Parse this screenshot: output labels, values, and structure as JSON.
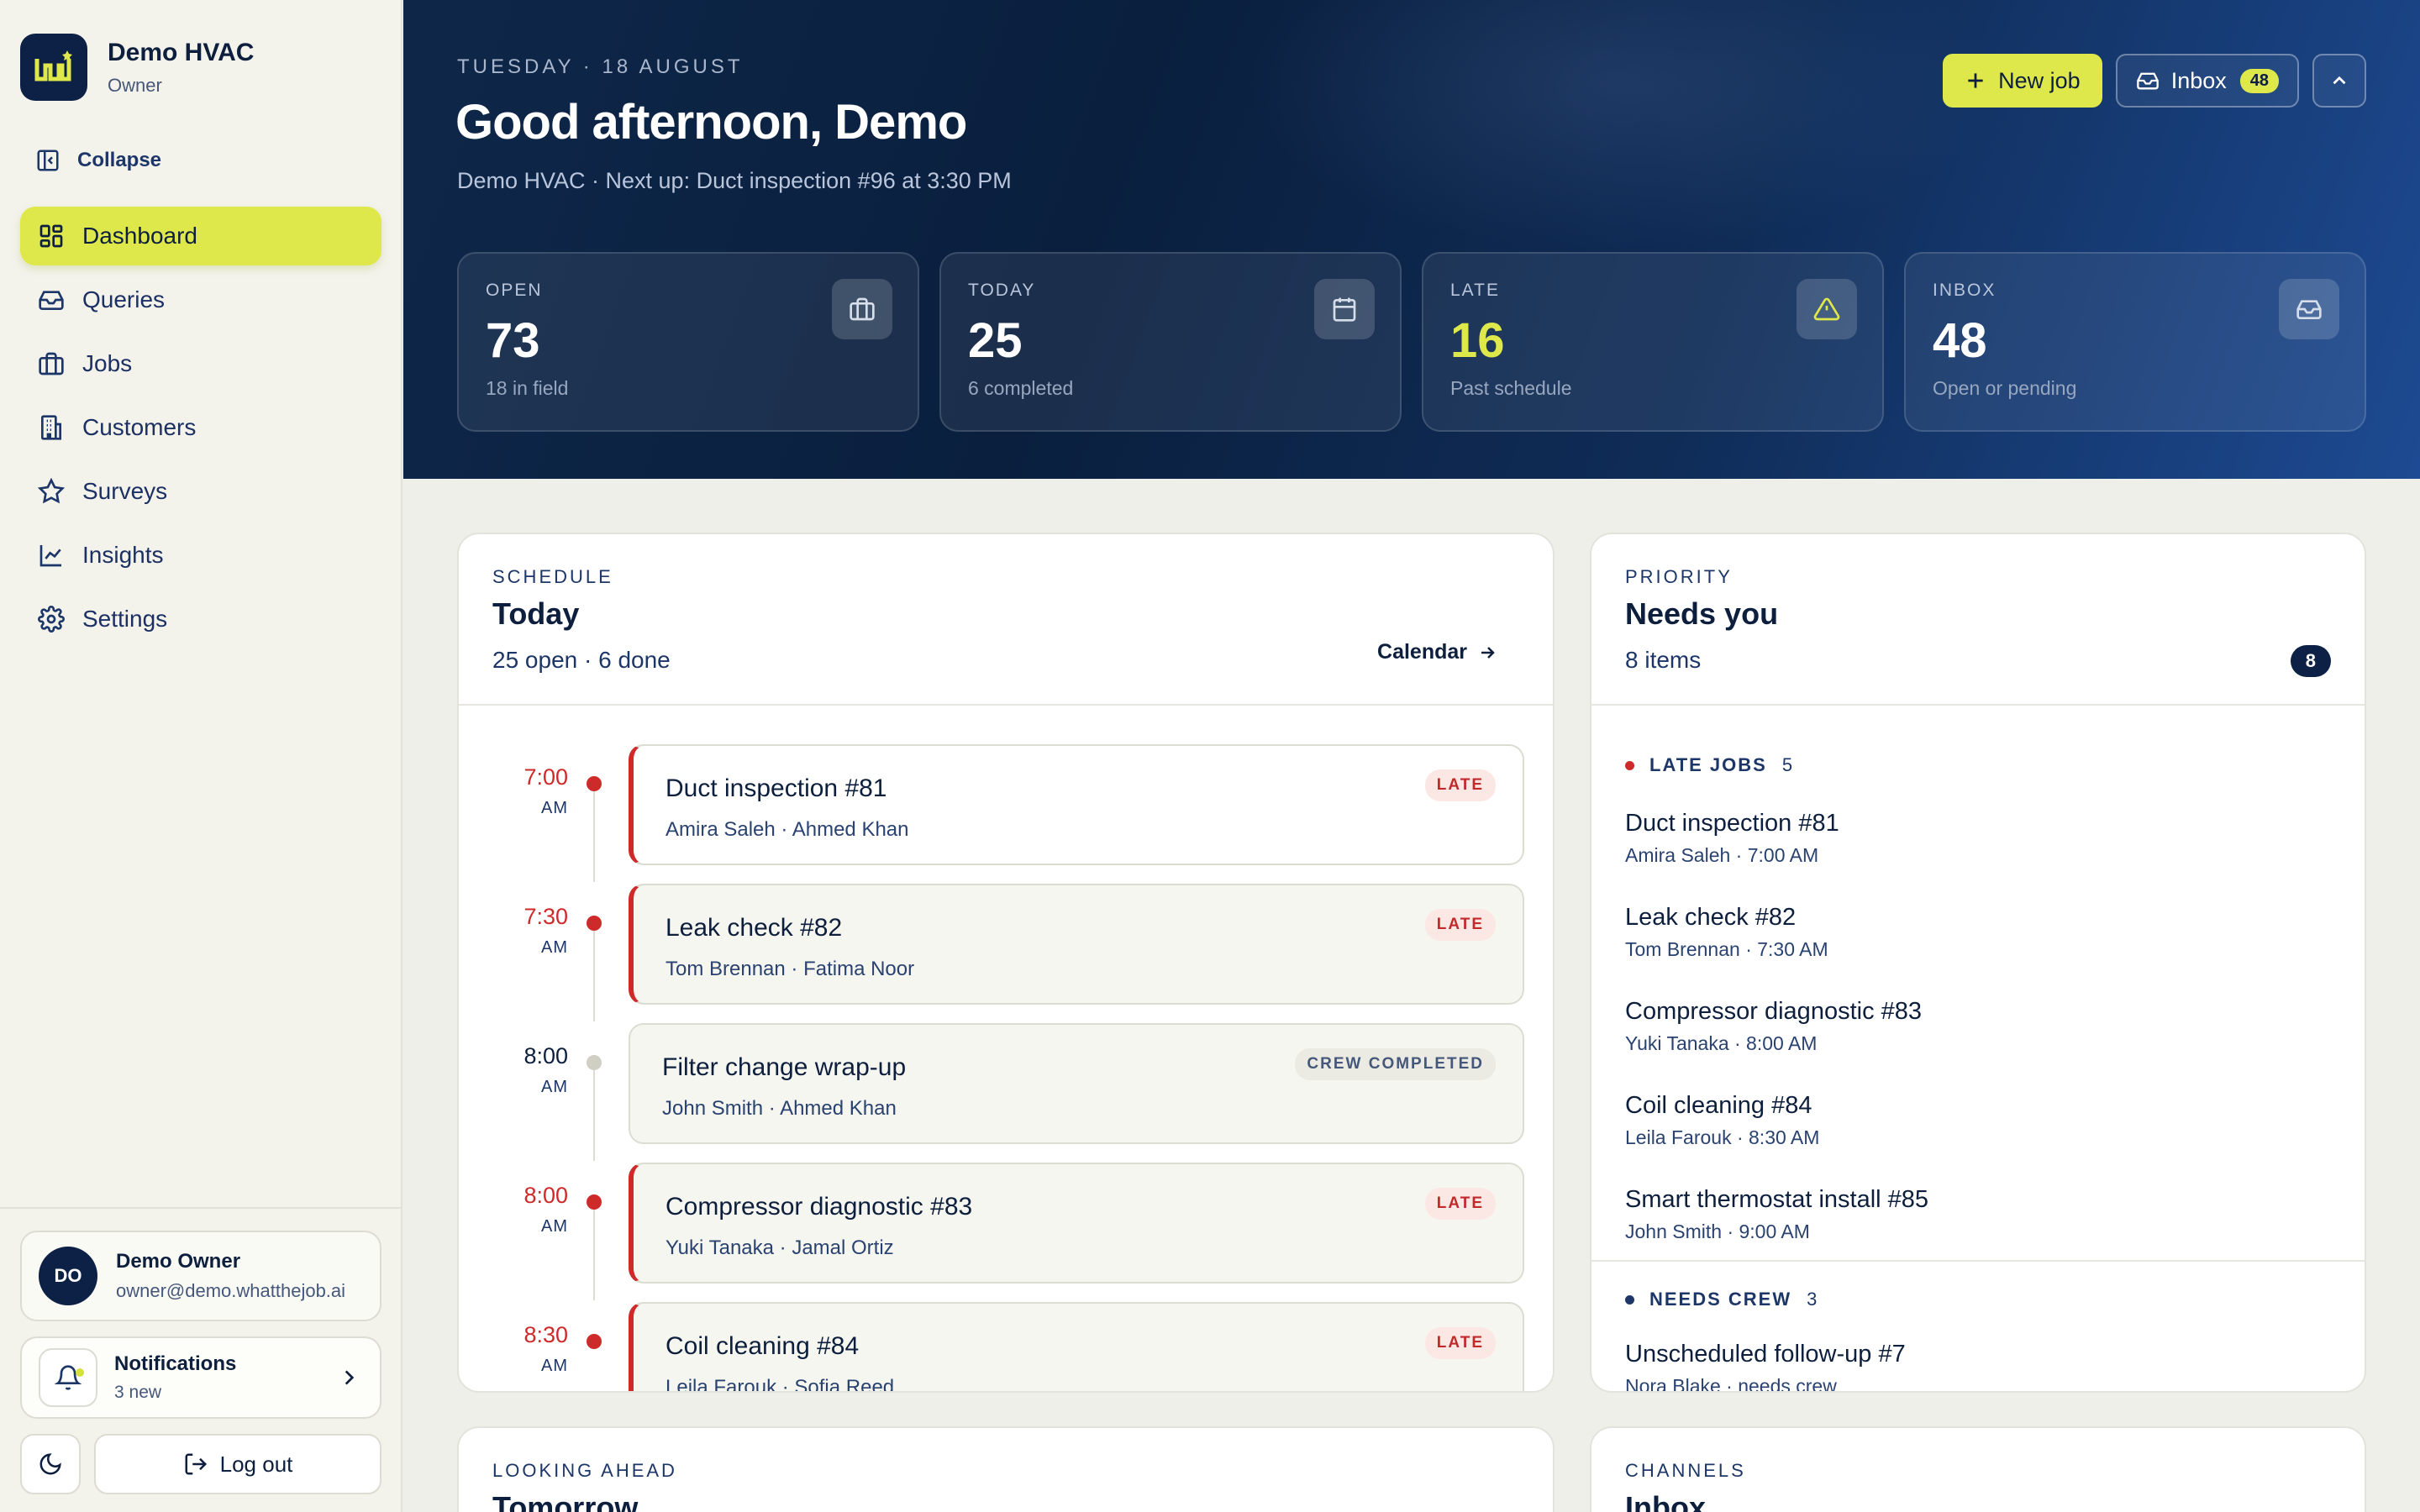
{
  "sidebar": {
    "brand_name": "Demo HVAC",
    "brand_role": "Owner",
    "collapse_label": "Collapse",
    "nav": [
      {
        "label": "Dashboard",
        "icon": "grid-icon",
        "active": true
      },
      {
        "label": "Queries",
        "icon": "inbox-icon"
      },
      {
        "label": "Jobs",
        "icon": "briefcase-icon"
      },
      {
        "label": "Customers",
        "icon": "building-icon"
      },
      {
        "label": "Surveys",
        "icon": "star-icon"
      },
      {
        "label": "Insights",
        "icon": "chart-line-icon"
      },
      {
        "label": "Settings",
        "icon": "gear-icon"
      }
    ],
    "user": {
      "initials": "DO",
      "name": "Demo Owner",
      "email": "owner@demo.whatthejob.ai"
    },
    "notifications": {
      "title": "Notifications",
      "sub": "3 new"
    },
    "logout_label": "Log out"
  },
  "header": {
    "date": "TUESDAY · 18 AUGUST",
    "greeting": "Good afternoon, Demo",
    "subline": "Demo HVAC · Next up: Duct inspection #96 at 3:30 PM",
    "new_job_label": "New job",
    "inbox_label": "Inbox",
    "inbox_count": "48"
  },
  "stats": [
    {
      "label": "OPEN",
      "value": "73",
      "sub": "18 in field",
      "icon": "briefcase-icon"
    },
    {
      "label": "TODAY",
      "value": "25",
      "sub": "6 completed",
      "icon": "calendar-icon"
    },
    {
      "label": "LATE",
      "value": "16",
      "sub": "Past schedule",
      "icon": "warning-icon"
    },
    {
      "label": "INBOX",
      "value": "48",
      "sub": "Open or pending",
      "icon": "inbox-icon"
    }
  ],
  "schedule": {
    "kicker": "SCHEDULE",
    "title": "Today",
    "sub": "25 open · 6 done",
    "calendar_label": "Calendar",
    "items": [
      {
        "time": "7:00",
        "ampm": "AM",
        "title": "Duct inspection #81",
        "meta": "Amira Saleh · Ahmed Khan",
        "tag": "LATE",
        "status": "late"
      },
      {
        "time": "7:30",
        "ampm": "AM",
        "title": "Leak check #82",
        "meta": "Tom Brennan · Fatima Noor",
        "tag": "LATE",
        "status": "late"
      },
      {
        "time": "8:00",
        "ampm": "AM",
        "title": "Filter change wrap-up",
        "meta": "John Smith · Ahmed Khan",
        "tag": "CREW COMPLETED",
        "status": "done"
      },
      {
        "time": "8:00",
        "ampm": "AM",
        "title": "Compressor diagnostic #83",
        "meta": "Yuki Tanaka · Jamal Ortiz",
        "tag": "LATE",
        "status": "late"
      },
      {
        "time": "8:30",
        "ampm": "AM",
        "title": "Coil cleaning #84",
        "meta": "Leila Farouk · Sofia Reed",
        "tag": "LATE",
        "status": "late"
      }
    ]
  },
  "priority": {
    "kicker": "PRIORITY",
    "title": "Needs you",
    "sub": "8 items",
    "count": "8",
    "late_section": {
      "label": "LATE JOBS",
      "count": "5"
    },
    "late_items": [
      {
        "title": "Duct inspection #81",
        "meta": "Amira Saleh · 7:00 AM"
      },
      {
        "title": "Leak check #82",
        "meta": "Tom Brennan · 7:30 AM"
      },
      {
        "title": "Compressor diagnostic #83",
        "meta": "Yuki Tanaka · 8:00 AM"
      },
      {
        "title": "Coil cleaning #84",
        "meta": "Leila Farouk · 8:30 AM"
      },
      {
        "title": "Smart thermostat install #85",
        "meta": "John Smith · 9:00 AM"
      }
    ],
    "crew_section": {
      "label": "NEEDS CREW",
      "count": "3"
    },
    "crew_items": [
      {
        "title": "Unscheduled follow-up #7",
        "meta": "Nora Blake · needs crew"
      }
    ]
  },
  "ahead": {
    "kicker": "LOOKING AHEAD",
    "title": "Tomorrow"
  },
  "channels": {
    "kicker": "CHANNELS",
    "title": "Inbox"
  },
  "colors": {
    "accent": "#dfe84b",
    "navy": "#0d2146",
    "late": "#cf2a2a"
  }
}
